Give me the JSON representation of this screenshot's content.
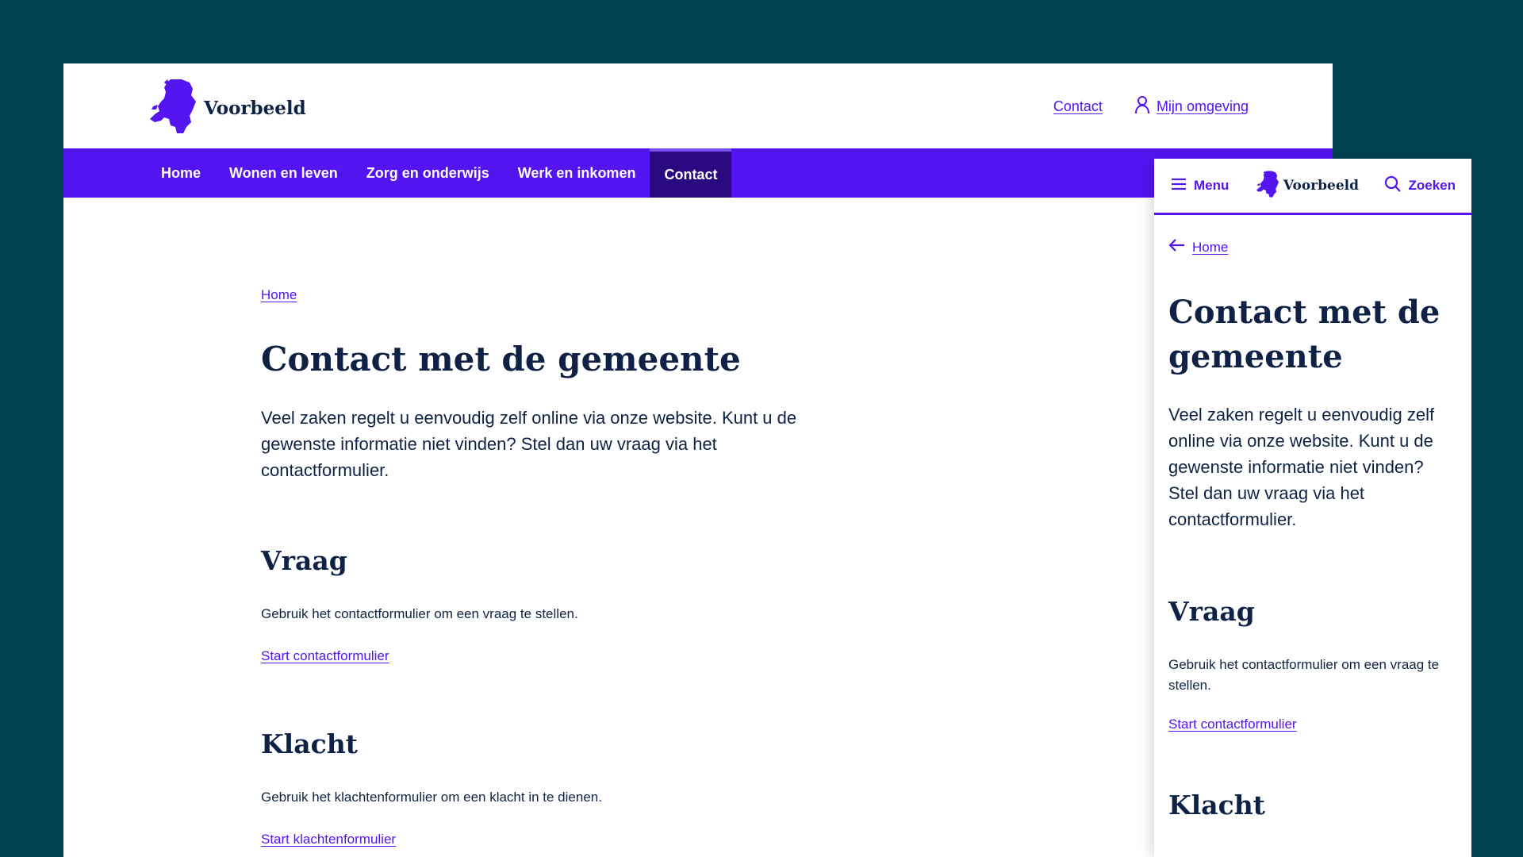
{
  "colors": {
    "background": "#004152",
    "brand": "#5314f0",
    "nav_active": "#2a0880",
    "text": "#0f2245",
    "surface": "#ffffff"
  },
  "brand": {
    "name": "Voorbeeld",
    "logo_icon": "netherlands-map-icon"
  },
  "desktop": {
    "header": {
      "contact_link": "Contact",
      "account_link": "Mijn omgeving",
      "account_icon": "user-icon"
    },
    "nav": {
      "items": [
        {
          "label": "Home"
        },
        {
          "label": "Wonen en leven"
        },
        {
          "label": "Zorg en onderwijs"
        },
        {
          "label": "Werk en inkomen"
        },
        {
          "label": "Contact",
          "active": true
        }
      ]
    },
    "main": {
      "breadcrumb": "Home",
      "title": "Contact met de gemeente",
      "intro": "Veel zaken regelt u eenvoudig zelf online via onze website. Kunt u de gewenste informatie niet vinden? Stel dan uw vraag via het contactformulier.",
      "sections": [
        {
          "heading": "Vraag",
          "text": "Gebruik het contactformulier om een vraag te stellen.",
          "link": "Start contactformulier"
        },
        {
          "heading": "Klacht",
          "text": "Gebruik het klachtenformulier om een klacht in te dienen.",
          "link": "Start klachtenformulier"
        }
      ]
    }
  },
  "mobile": {
    "header": {
      "menu_label": "Menu",
      "menu_icon": "hamburger-icon",
      "search_label": "Zoeken",
      "search_icon": "search-icon"
    },
    "main": {
      "back_link": "Home",
      "back_icon": "arrow-left-icon",
      "title": "Contact met de gemeente",
      "intro": "Veel zaken regelt u eenvoudig zelf online via onze website. Kunt u de gewenste informatie niet vinden? Stel dan uw vraag via het contactformulier.",
      "sections": [
        {
          "heading": "Vraag",
          "text": "Gebruik het contactformulier om een vraag te stellen.",
          "link": "Start contactformulier"
        },
        {
          "heading": "Klacht"
        }
      ]
    }
  }
}
